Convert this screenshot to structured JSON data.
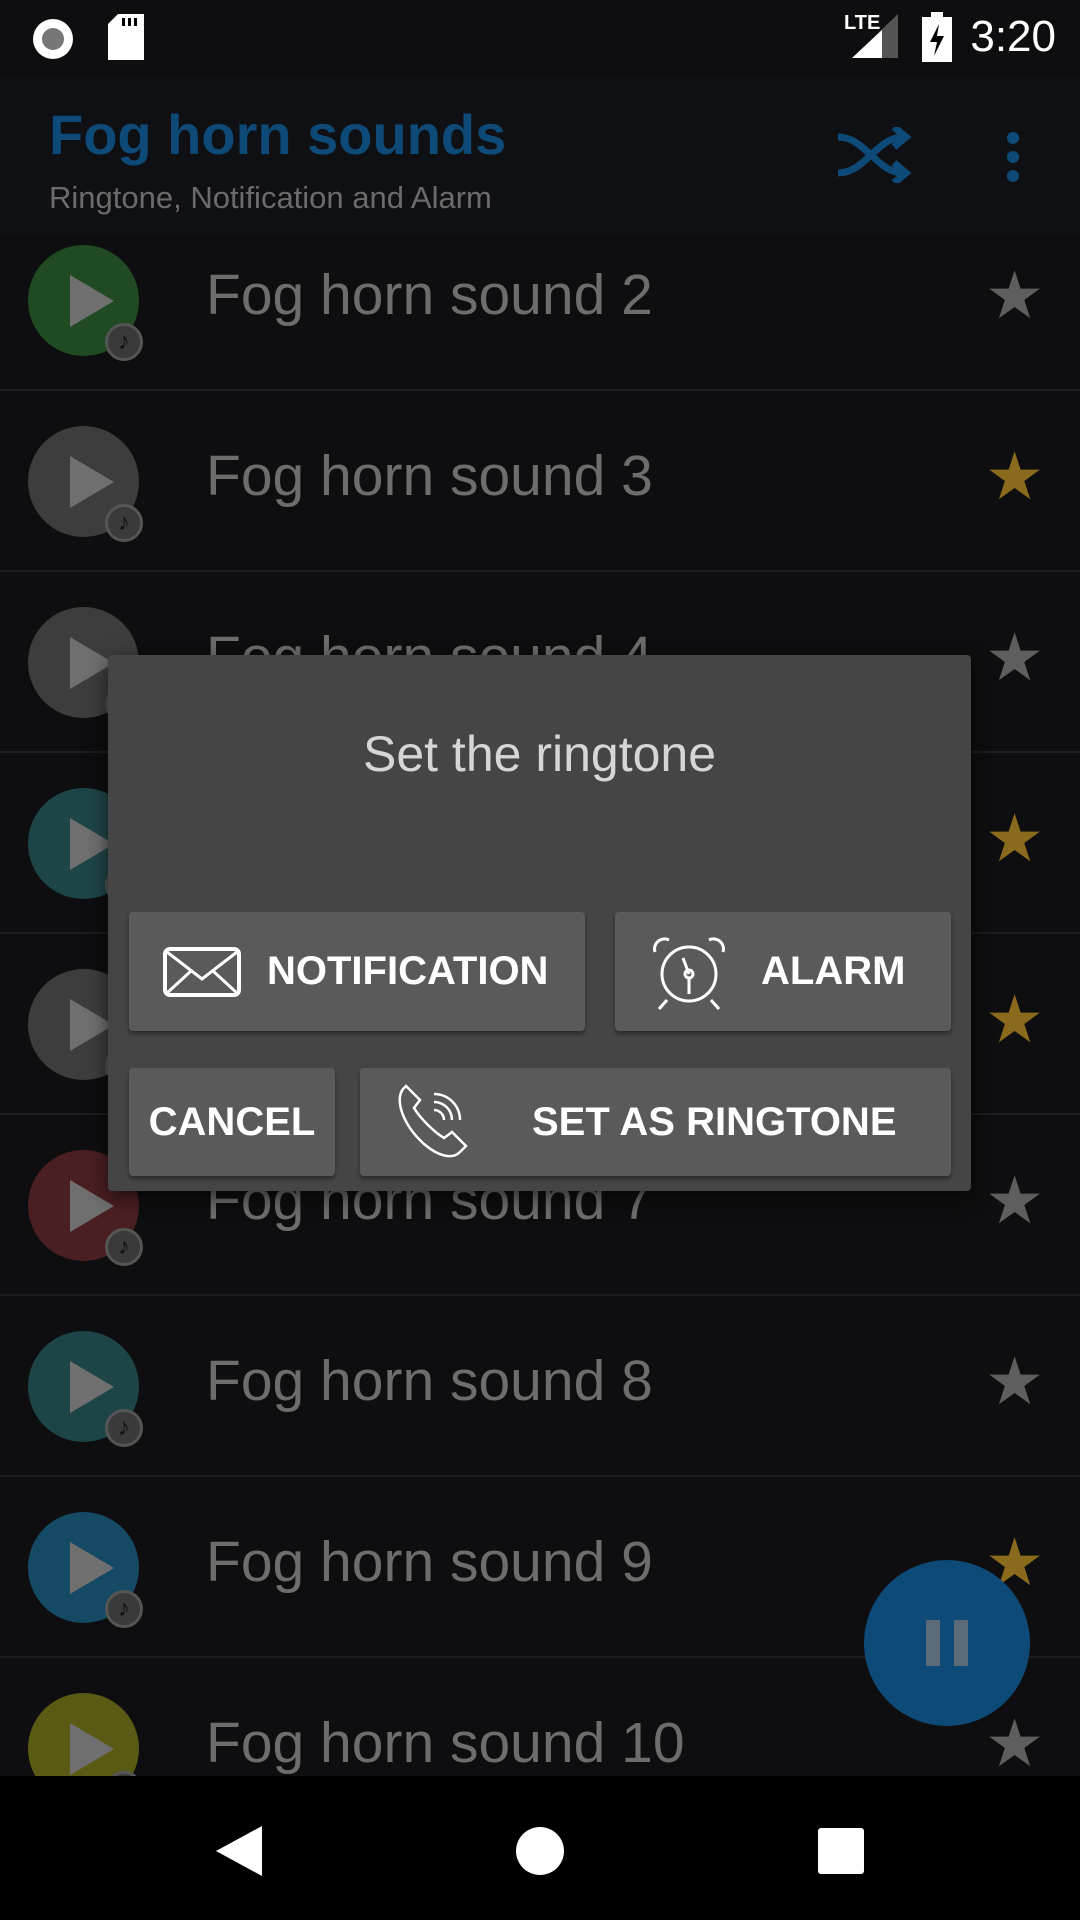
{
  "status_bar": {
    "time": "3:20",
    "network": "LTE",
    "icons": [
      "record-icon",
      "sd-card-icon",
      "signal-icon",
      "battery-charging-icon"
    ]
  },
  "toolbar": {
    "title": "Fog horn sounds",
    "subtitle": "Ringtone, Notification and Alarm",
    "actions": [
      "shuffle-icon",
      "more-vert-icon"
    ]
  },
  "colors": {
    "accent": "#0e4a78",
    "star_on": "#8a6a1c",
    "star_off": "#5e5e5e"
  },
  "list": [
    {
      "label": "Fog horn sound 2",
      "color": "#1f4a22",
      "favorite": false
    },
    {
      "label": "Fog horn sound 3",
      "color": "#3d3d3d",
      "favorite": true
    },
    {
      "label": "Fog horn sound 4",
      "color": "#3d3d3d",
      "favorite": false
    },
    {
      "label": "",
      "color": "#1d4548",
      "favorite": true
    },
    {
      "label": "",
      "color": "#3d3d3d",
      "favorite": true
    },
    {
      "label": "Fog horn sound 7",
      "color": "#4a1f22",
      "favorite": false
    },
    {
      "label": "Fog horn sound 8",
      "color": "#1d4548",
      "favorite": false
    },
    {
      "label": "Fog horn sound 9",
      "color": "#154a64",
      "favorite": true
    },
    {
      "label": "Fog horn sound 10",
      "color": "#5a5a14",
      "favorite": false
    }
  ],
  "dialog": {
    "title": "Set the ringtone",
    "notification": "NOTIFICATION",
    "alarm": "ALARM",
    "cancel": "CANCEL",
    "ringtone": "SET AS RINGTONE"
  },
  "fab": {
    "icon": "pause-icon"
  }
}
